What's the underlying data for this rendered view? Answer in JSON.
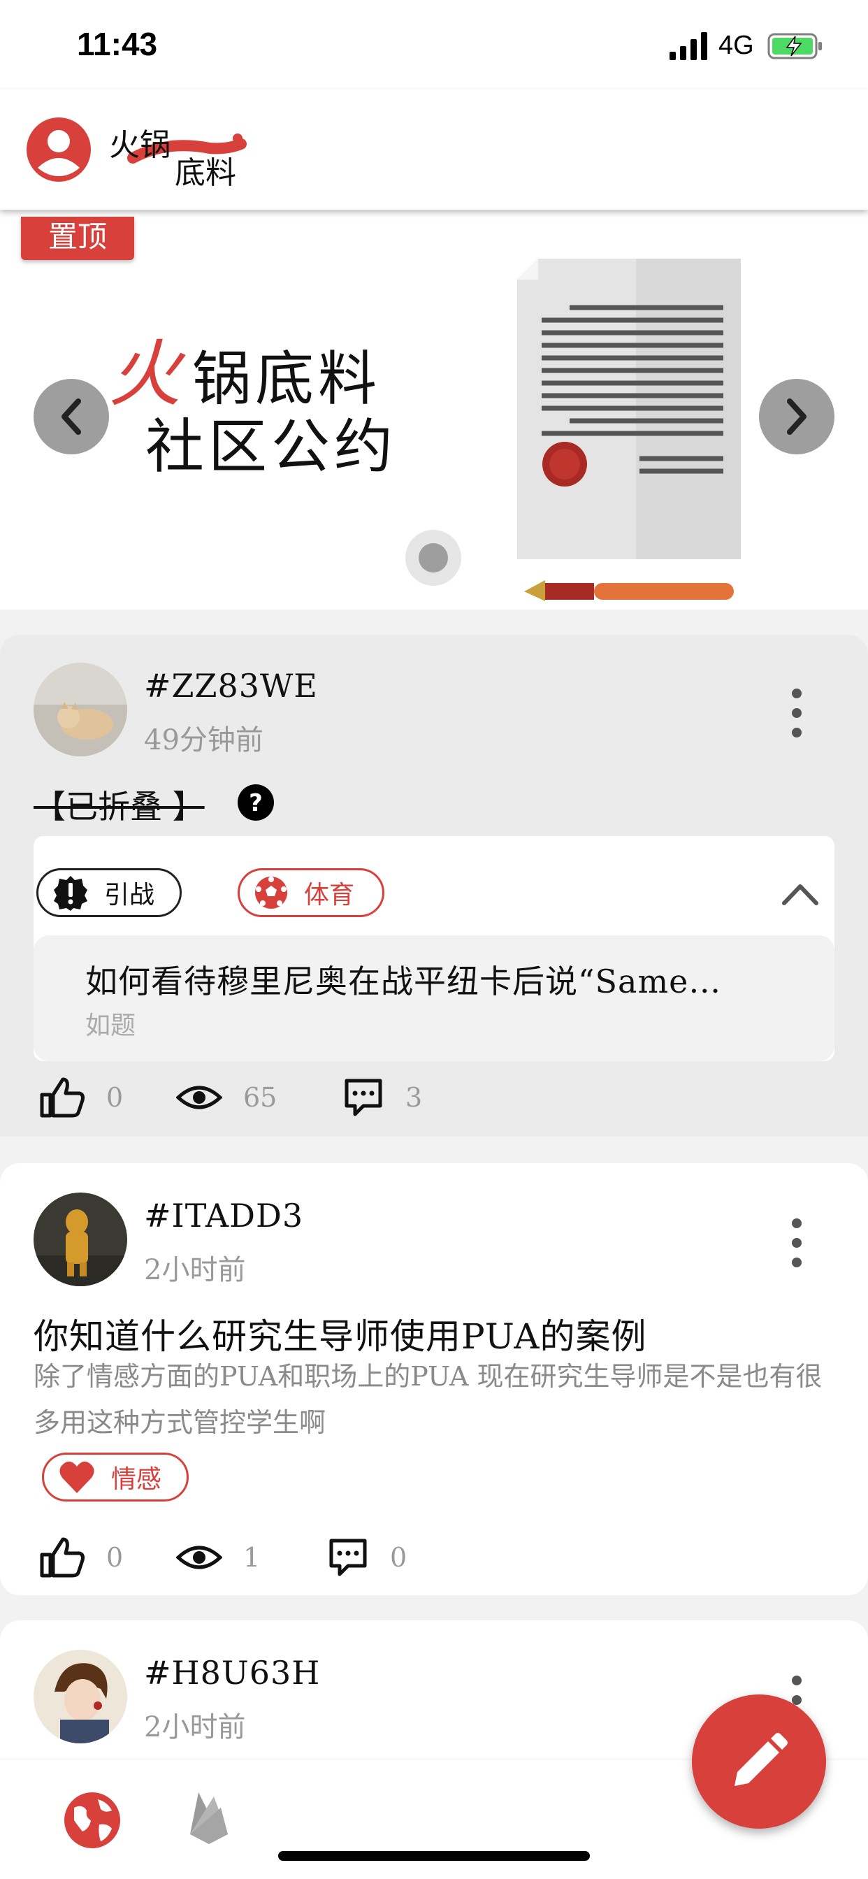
{
  "status_bar": {
    "time": "11:43",
    "network": "4G"
  },
  "header": {
    "logo_text": "火锅底料"
  },
  "banner": {
    "pin_label": "置顶",
    "title_accent": "火",
    "title_line1_rest": "锅底料",
    "title_line2": "社区公约"
  },
  "posts": [
    {
      "user_id": "#ZZ83WE",
      "time": "49分钟前",
      "folded_label": "【已折叠 】",
      "tags": [
        "引战",
        "体育"
      ],
      "quote_title": "如何看待穆里尼奥在战平纽卡后说“Same…",
      "quote_sub": "如题",
      "likes": "0",
      "views": "65",
      "comments": "3"
    },
    {
      "user_id": "#ITADD3",
      "time": "2小时前",
      "title": "你知道什么研究生导师使用PUA的案例",
      "body": "除了情感方面的PUA和职场上的PUA 现在研究生导师是不是也有很多用这种方式管控学生啊",
      "tags": [
        "情感"
      ],
      "likes": "0",
      "views": "1",
      "comments": "0"
    },
    {
      "user_id": "#H8U63H",
      "time": "2小时前"
    }
  ],
  "colors": {
    "brand_red": "#d8413b",
    "muted_gray": "#9e9e9e"
  },
  "icons": {
    "fab": "pencil-icon",
    "nav": [
      "globe-icon",
      "firebase-icon"
    ],
    "stats": [
      "thumbs-up-icon",
      "eye-icon",
      "comment-icon"
    ]
  }
}
